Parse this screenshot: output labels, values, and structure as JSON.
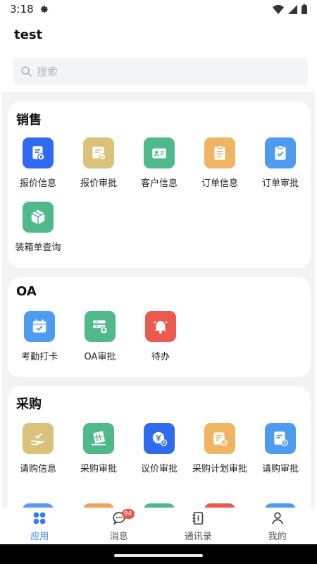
{
  "status": {
    "time": "3:18"
  },
  "header": {
    "title": "test"
  },
  "search": {
    "placeholder": "搜索"
  },
  "sections": [
    {
      "title": "销售",
      "items": [
        {
          "label": "报价信息",
          "icon": "quote-doc-icon",
          "color": "#2f6bf0"
        },
        {
          "label": "报价审批",
          "icon": "quote-approve-icon",
          "color": "#dbc27a"
        },
        {
          "label": "客户信息",
          "icon": "customer-card-icon",
          "color": "#4fb98a"
        },
        {
          "label": "订单信息",
          "icon": "order-clipboard-icon",
          "color": "#efb563"
        },
        {
          "label": "订单审批",
          "icon": "order-approve-icon",
          "color": "#4e9cf2"
        },
        {
          "label": "装箱单查询",
          "icon": "package-box-icon",
          "color": "#4fb98a"
        }
      ]
    },
    {
      "title": "OA",
      "items": [
        {
          "label": "考勤打卡",
          "icon": "calendar-check-icon",
          "color": "#4e9cf2"
        },
        {
          "label": "OA审批",
          "icon": "oa-approve-icon",
          "color": "#4fb98a"
        },
        {
          "label": "待办",
          "icon": "bell-icon",
          "color": "#ea5a4e"
        }
      ]
    },
    {
      "title": "采购",
      "items": [
        {
          "label": "请购信息",
          "icon": "hand-request-icon",
          "color": "#dbc27a"
        },
        {
          "label": "采购审批",
          "icon": "purchase-grid-icon",
          "color": "#4fb98a"
        },
        {
          "label": "议价审批",
          "icon": "bargain-icon",
          "color": "#2f6bf0"
        },
        {
          "label": "采购计划审批",
          "icon": "purchase-plan-icon",
          "color": "#efb563"
        },
        {
          "label": "请购审批",
          "icon": "request-approve-icon",
          "color": "#4e9cf2"
        }
      ]
    }
  ],
  "partial_row_colors": [
    "#5b9cf0",
    "#f0a25a",
    "#4fb98a",
    "#ea5a4e",
    "#4e9cf2"
  ],
  "tabs": [
    {
      "label": "应用",
      "icon": "apps-icon",
      "active": true
    },
    {
      "label": "消息",
      "icon": "chat-icon",
      "badge": "94"
    },
    {
      "label": "通讯录",
      "icon": "contacts-icon"
    },
    {
      "label": "我的",
      "icon": "profile-icon"
    }
  ],
  "colors": {
    "accent": "#2f7ef5",
    "badge": "#f0554b"
  }
}
